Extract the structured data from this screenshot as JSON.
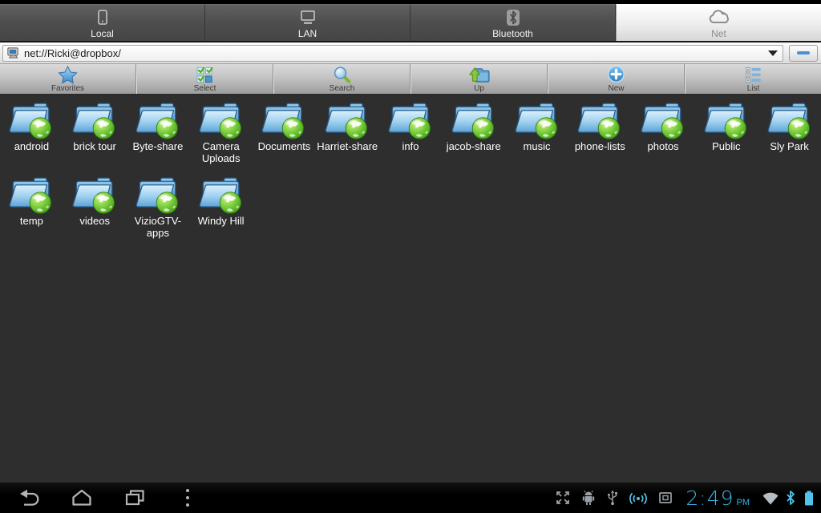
{
  "tabs": [
    {
      "label": "Local",
      "icon": "phone-icon",
      "selected": false
    },
    {
      "label": "LAN",
      "icon": "lan-icon",
      "selected": false
    },
    {
      "label": "Bluetooth",
      "icon": "bluetooth-icon",
      "selected": false
    },
    {
      "label": "Net",
      "icon": "cloud-icon",
      "selected": true
    }
  ],
  "address_bar": {
    "value": "net://Ricki@dropbox/",
    "icon": "computer-icon",
    "dropdown_icon": "caret-down-icon",
    "hide_button_icon": "minus-icon"
  },
  "toolbar": {
    "buttons": [
      "Favorites",
      "Select",
      "Search",
      "Up",
      "New",
      "List"
    ],
    "icons": [
      "star-icon",
      "multi-select-icon",
      "search-icon",
      "folder-up-icon",
      "plus-icon",
      "list-view-icon"
    ]
  },
  "folders": [
    "android",
    "brick tour",
    "Byte-share",
    "Camera Uploads",
    "Documents",
    "Harriet-share",
    "info",
    "jacob-share",
    "music",
    "phone-lists",
    "photos",
    "Public",
    "Sly Park",
    "temp",
    "videos",
    "VizioGTV-apps",
    "Windy Hill"
  ],
  "system_bar": {
    "nav_icons": [
      "back",
      "home",
      "recents",
      "menu"
    ],
    "status_icons": [
      "expand",
      "adb-robot",
      "usb",
      "hotspot",
      "screen-frame",
      "wifi",
      "bluetooth",
      "battery"
    ],
    "clock": {
      "time": "2:49",
      "ampm": "PM"
    }
  },
  "colors": {
    "accent_blue": "#33b5e5",
    "content_bg": "#2e2e2e",
    "folder_blue": "#5ea3d6",
    "globe_green": "#57b32a",
    "tab_dark": "#4f4f4f",
    "tab_selected": "#ededed"
  }
}
